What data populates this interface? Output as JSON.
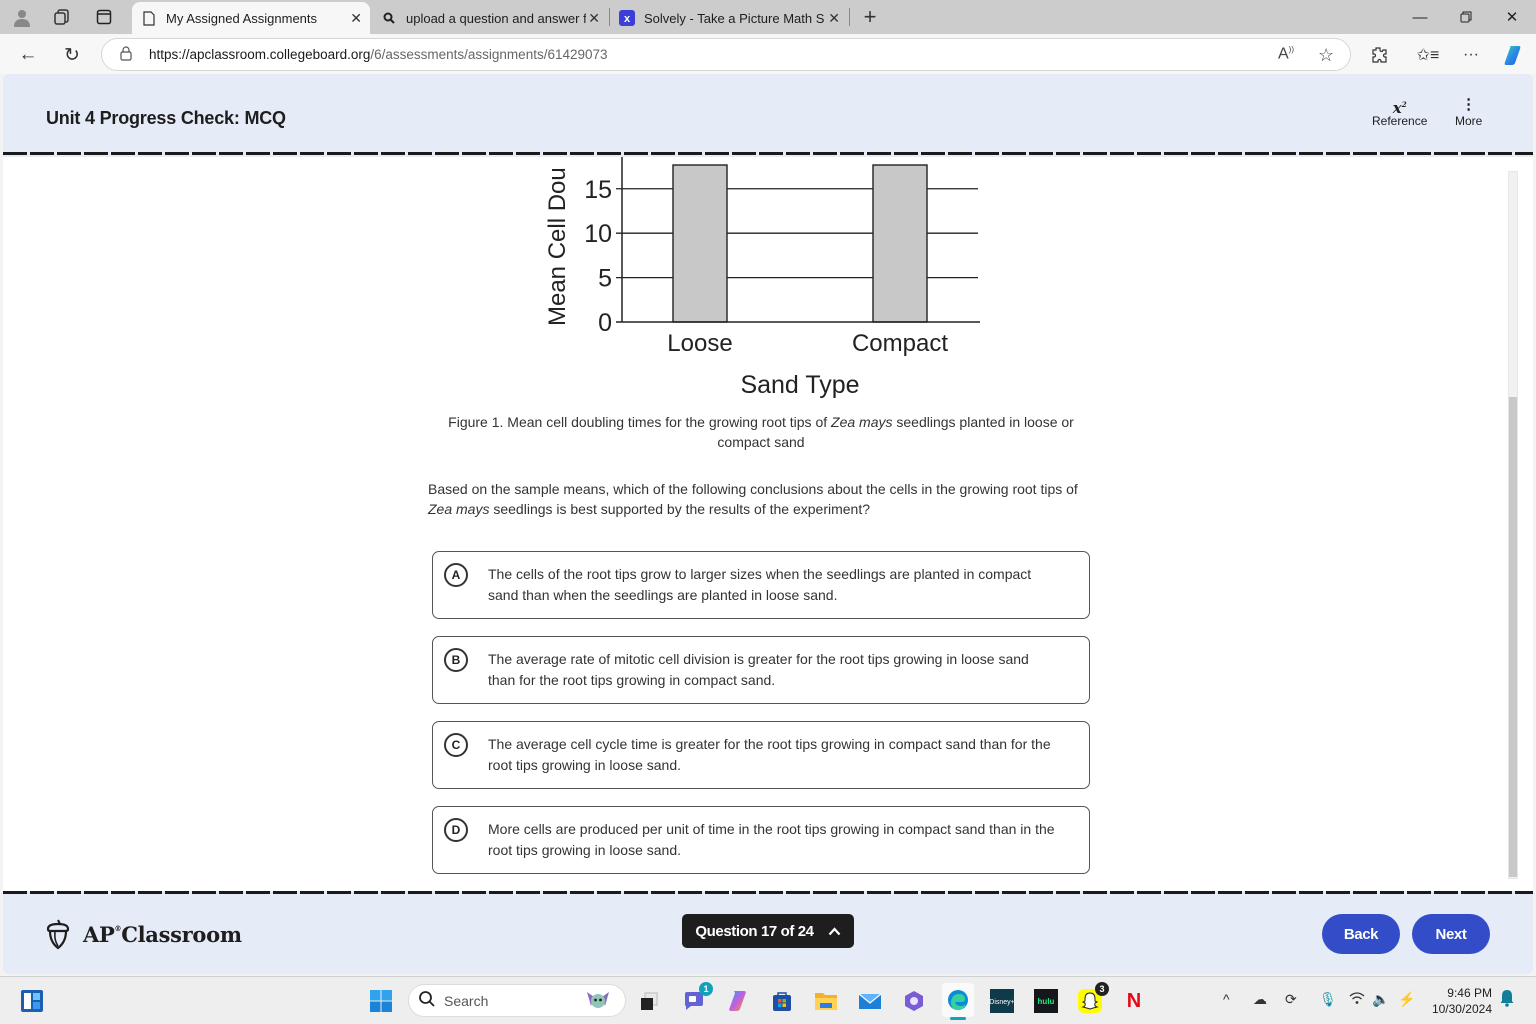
{
  "browser": {
    "tabs": [
      {
        "title": "My Assigned Assignments",
        "icon": "page-icon",
        "active": true
      },
      {
        "title": "upload a question and answer for",
        "icon": "search-icon",
        "active": false
      },
      {
        "title": "Solvely - Take a Picture Math Solv",
        "icon": "solvely-icon",
        "active": false
      }
    ],
    "new_tab_label": "+",
    "url_host": "https://apclassroom.collegeboard.org",
    "url_path": "/6/assessments/assignments/61429073"
  },
  "header": {
    "title": "Unit 4 Progress Check: MCQ",
    "reference_label": "Reference",
    "reference_icon_text": "x",
    "reference_icon_sup": "2",
    "more_label": "More",
    "more_icon_text": "⋮"
  },
  "chart_data": {
    "type": "bar",
    "categories": [
      "Loose",
      "Compact"
    ],
    "values": [
      17,
      17
    ],
    "values_note": "bars extend beyond visible (cropped) area; tops not visible",
    "xlabel": "Sand Type",
    "ylabel": "Mean Cell Dou",
    "yticks": [
      0,
      5,
      10,
      15
    ],
    "ylim": [
      0,
      17
    ],
    "grid": true,
    "bar_color": "#c8c8c8"
  },
  "figure": {
    "caption_pre": "Figure 1. Mean cell doubling times for the growing root tips of ",
    "caption_italic": "Zea mays",
    "caption_post": " seedlings planted in loose or compact sand"
  },
  "question": {
    "pre": "Based on the sample means, which of the following conclusions about the cells in the growing root tips of ",
    "italic": "Zea mays",
    "post": " seedlings is best supported by the results of the experiment?"
  },
  "options": [
    {
      "letter": "A",
      "text": "The cells of the root tips grow to larger sizes when the seedlings are planted in compact sand than when the seedlings are planted in loose sand."
    },
    {
      "letter": "B",
      "text": "The average rate of mitotic cell division is greater for the root tips growing in loose sand than for the root tips growing in compact sand."
    },
    {
      "letter": "C",
      "text": "The average cell cycle time is greater for the root tips growing in compact sand than for the root tips growing in loose sand."
    },
    {
      "letter": "D",
      "text": "More cells are produced per unit of time in the root tips growing in compact sand than in the root tips growing in loose sand."
    }
  ],
  "footer": {
    "logo_ap": "AP",
    "logo_reg": "®",
    "logo_classroom": "Classroom",
    "question_nav": "Question 17 of 24",
    "question_nav_icon": "^",
    "back_label": "Back",
    "next_label": "Next",
    "accent_color": "#324dc7"
  },
  "taskbar": {
    "search_placeholder": "Search",
    "teams_badge": "1",
    "snapchat_badge": "3",
    "time": "9:46 PM",
    "date": "10/30/2024"
  }
}
